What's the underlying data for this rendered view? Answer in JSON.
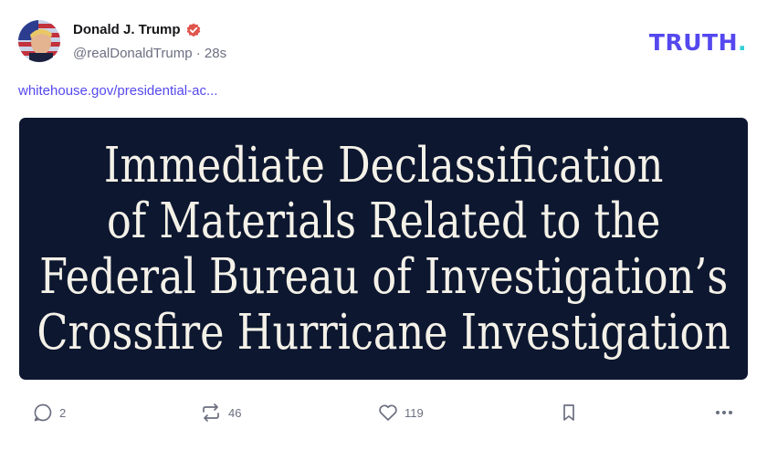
{
  "post": {
    "display_name": "Donald J. Trump",
    "handle": "@realDonaldTrump",
    "separator": "·",
    "time": "28s",
    "link_text": "whitehouse.gov/presidential-ac...",
    "media_title_lines": [
      "Immediate Declassification",
      "of Materials Related to the",
      "Federal Bureau of Investigation’s",
      "Crossfire Hurricane Investigation"
    ]
  },
  "brand": {
    "logo_text": "TRUTH",
    "logo_dot": ".",
    "primary_color": "#5448ee",
    "accent_color": "#2fcfd6"
  },
  "actions": {
    "replies": "2",
    "retruths": "46",
    "likes": "119"
  },
  "icons": {
    "verified": "verified-badge-icon",
    "reply": "reply-icon",
    "retruth": "retruth-icon",
    "like": "heart-icon",
    "bookmark": "bookmark-icon",
    "more": "more-options-icon"
  },
  "colors": {
    "media_background": "#0d1730",
    "muted_text": "#6b6f80",
    "verified_badge": "#e0554d"
  }
}
